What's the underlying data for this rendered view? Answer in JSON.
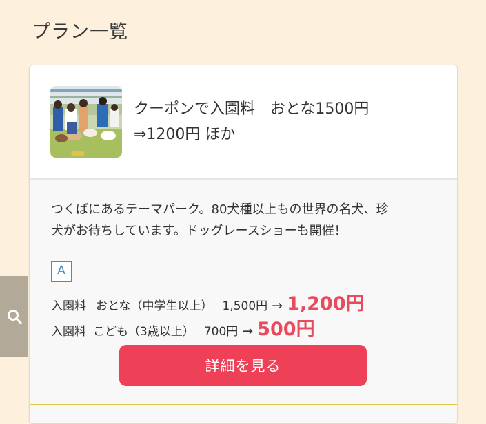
{
  "page": {
    "title": "プラン一覧"
  },
  "plan": {
    "title_line1": "クーポンで入園料　おとな1500円",
    "title_line2": "⇒1200円 ほか",
    "description_line1": "つくばにあるテーマパーク。80犬種以上もの世界の名犬、珍",
    "description_line2": "犬がお待ちしています。ドッグレースショーも開催！",
    "badge": "A",
    "prices": [
      {
        "label": "入園料",
        "category": "おとな（中学生以上）",
        "old_price": "1,500円",
        "arrow": "→",
        "new_price": "1,200円"
      },
      {
        "label": "入園料",
        "category": "こども（3歳以上）",
        "old_price": "700円",
        "arrow": "→",
        "new_price": "500円"
      }
    ],
    "detail_button": "詳細を見る",
    "thumbnail_icon": "dog-park-photo"
  },
  "side": {
    "search_icon": "search-icon"
  },
  "colors": {
    "background": "#fdf0dd",
    "accent": "#ee4157",
    "price_highlight": "#e94a5d",
    "badge_blue": "#3c8fd0",
    "side_tab": "#b3a998"
  }
}
